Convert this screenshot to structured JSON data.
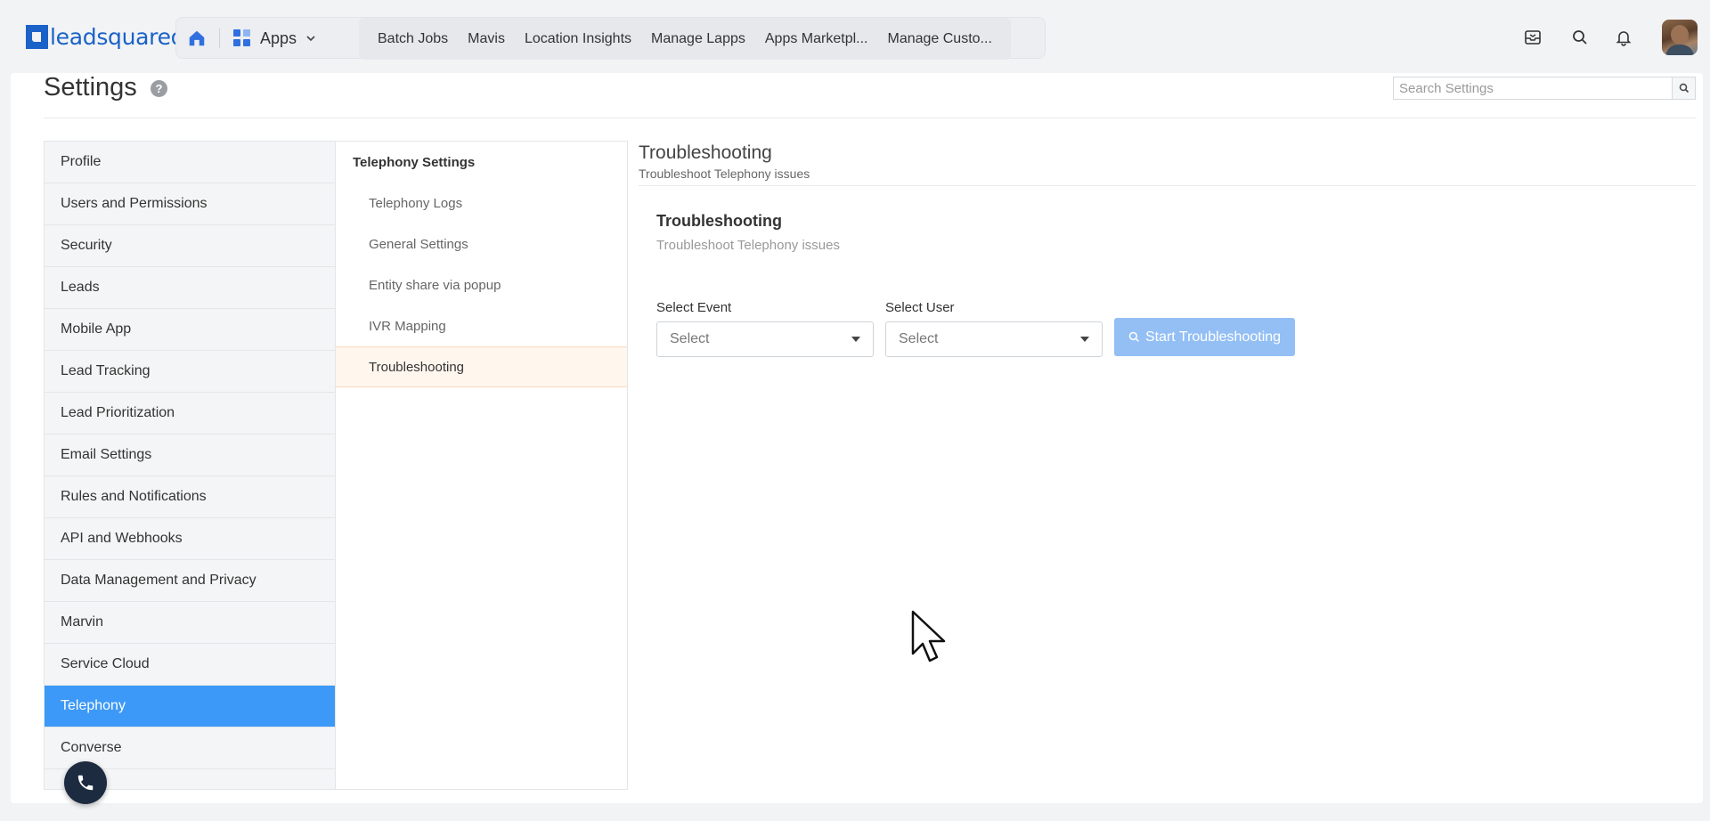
{
  "brand": {
    "logo_text": "leadsquared",
    "accent": "#1a62c8"
  },
  "topnav": {
    "apps_label": "Apps",
    "links": [
      "Batch Jobs",
      "Mavis",
      "Location Insights",
      "Manage Lapps",
      "Apps Marketpl...",
      "Manage Custo..."
    ],
    "icons": [
      "home-icon",
      "apps-grid-icon",
      "inbox-icon",
      "search-icon",
      "bell-icon",
      "avatar"
    ]
  },
  "header": {
    "title": "Settings",
    "help_glyph": "?",
    "search_placeholder": "Search Settings"
  },
  "leftnav": {
    "items": [
      "Profile",
      "Users and Permissions",
      "Security",
      "Leads",
      "Mobile App",
      "Lead Tracking",
      "Lead Prioritization",
      "Email Settings",
      "Rules and Notifications",
      "API and Webhooks",
      "Data Management and Privacy",
      "Marvin",
      "Service Cloud",
      "Telephony",
      "Converse"
    ],
    "active": "Telephony",
    "active_color": "#3c99f7"
  },
  "subnav": {
    "header": "Telephony Settings",
    "items": [
      "Telephony Logs",
      "General Settings",
      "Entity share via popup",
      "IVR Mapping",
      "Troubleshooting"
    ],
    "active": "Troubleshooting"
  },
  "main": {
    "title": "Troubleshooting",
    "subtitle": "Troubleshoot Telephony issues",
    "panel_title": "Troubleshooting",
    "panel_subtitle": "Troubleshoot Telephony issues",
    "event_label": "Select Event",
    "event_value": "Select",
    "user_label": "Select User",
    "user_value": "Select",
    "start_button": "Start Troubleshooting",
    "button_color": "#93bff5"
  }
}
